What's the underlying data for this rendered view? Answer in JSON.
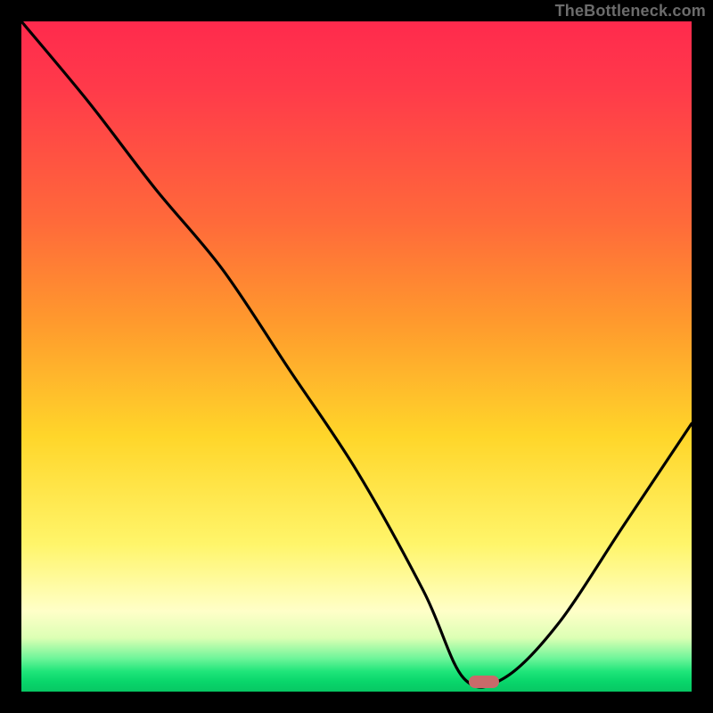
{
  "watermark": "TheBottleneck.com",
  "colors": {
    "frame": "#000000",
    "curve": "#000000",
    "marker": "#c96a6a",
    "gradient_top": "#ff2a4d",
    "gradient_bottom": "#07c763"
  },
  "chart_data": {
    "type": "line",
    "title": "",
    "xlabel": "",
    "ylabel": "",
    "xlim": [
      0,
      1
    ],
    "ylim": [
      0,
      1
    ],
    "series": [
      {
        "name": "bottleneck-curve",
        "x": [
          0.0,
          0.1,
          0.2,
          0.3,
          0.4,
          0.5,
          0.6,
          0.66,
          0.72,
          0.8,
          0.9,
          1.0
        ],
        "values": [
          1.0,
          0.88,
          0.75,
          0.63,
          0.48,
          0.33,
          0.15,
          0.02,
          0.02,
          0.1,
          0.25,
          0.4
        ]
      }
    ],
    "marker": {
      "x": 0.69,
      "y": 0.015
    },
    "notes": "No axis ticks or numeric labels are visible; values are normalized 0–1 estimates read from the figure."
  }
}
